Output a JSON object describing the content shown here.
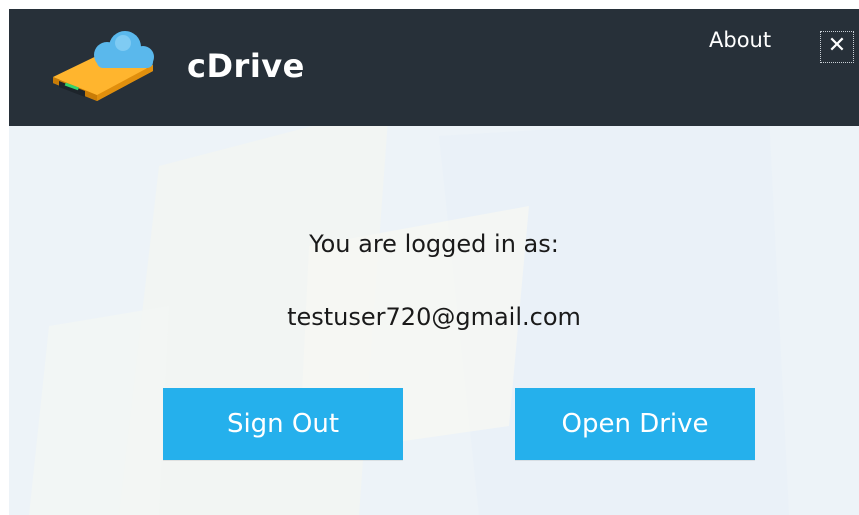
{
  "header": {
    "app_title": "cDrive",
    "about_label": "About",
    "close_glyph": "✕",
    "logo_icon": "cloud-drive-icon"
  },
  "main": {
    "login_label": "You are logged in as:",
    "email": "testuser720@gmail.com"
  },
  "actions": {
    "sign_out_label": "Sign Out",
    "open_drive_label": "Open Drive"
  },
  "colors": {
    "header_bg": "#273039",
    "content_bg": "#edf3f8",
    "button_bg": "#25b0ec",
    "button_text": "#ffffff"
  }
}
